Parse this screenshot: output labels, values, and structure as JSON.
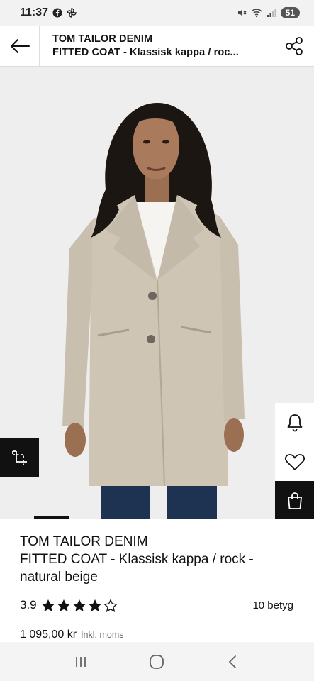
{
  "status_bar": {
    "time": "11:37",
    "battery": "51"
  },
  "header": {
    "brand": "TOM TAILOR DENIM",
    "product_name": "FITTED COAT - Klassisk kappa / roc..."
  },
  "product": {
    "brand": "TOM TAILOR DENIM",
    "title": "FITTED COAT - Klassisk kappa / rock - natural beige",
    "rating": "3.9",
    "rating_value": 3.9,
    "rating_max": 5,
    "review_count": "10 betyg",
    "price": "1 095,00 kr",
    "price_note": "Inkl. moms"
  },
  "colors": {
    "coat": "#cfc5b5",
    "background": "#eeeeee",
    "accent": "#111111"
  },
  "icons": {
    "back": "arrow-left-icon",
    "share": "share-icon",
    "view_similar": "crop-expand-icon",
    "notify": "bell-icon",
    "wishlist": "heart-icon",
    "bag": "shopping-bag-icon"
  }
}
